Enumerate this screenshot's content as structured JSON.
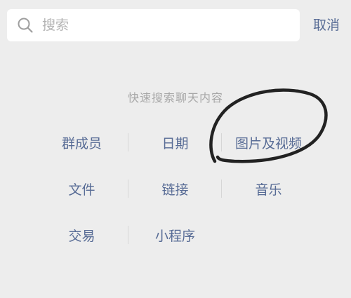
{
  "search": {
    "placeholder": "搜索",
    "cancel_label": "取消"
  },
  "hint": "快速搜索聊天内容",
  "categories": [
    [
      "群成员",
      "日期",
      "图片及视频"
    ],
    [
      "文件",
      "链接",
      "音乐"
    ],
    [
      "交易",
      "小程序"
    ]
  ],
  "colors": {
    "accent": "#576b95",
    "background": "#ededed",
    "hint": "#a7a7a7",
    "annotation": "#222222"
  }
}
